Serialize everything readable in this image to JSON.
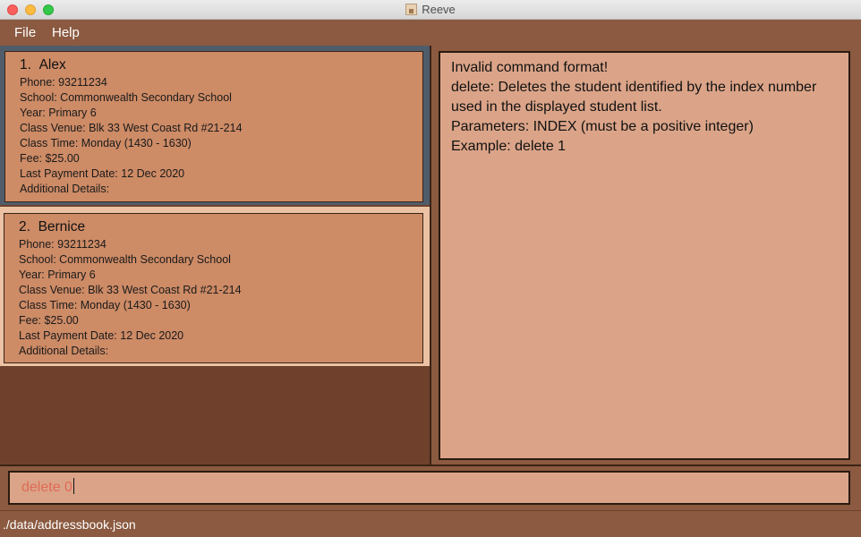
{
  "window": {
    "title": "Reeve"
  },
  "menu": {
    "items": [
      "File",
      "Help"
    ]
  },
  "students": [
    {
      "index": "1.",
      "name": "Alex",
      "phone": "Phone: 93211234",
      "school": "School: Commonwealth Secondary School",
      "year": "Year: Primary 6",
      "venue": "Class Venue: Blk 33 West Coast Rd #21-214",
      "time": "Class Time: Monday (1430 - 1630)",
      "fee": "Fee: $25.00",
      "last_payment": "Last Payment Date: 12 Dec 2020",
      "details": "Additional Details:"
    },
    {
      "index": "2.",
      "name": "Bernice",
      "phone": "Phone: 93211234",
      "school": "School: Commonwealth Secondary School",
      "year": "Year: Primary 6",
      "venue": "Class Venue: Blk 33 West Coast Rd #21-214",
      "time": "Class Time: Monday (1430 - 1630)",
      "fee": "Fee: $25.00",
      "last_payment": "Last Payment Date: 12 Dec 2020",
      "details": "Additional Details:"
    }
  ],
  "result": {
    "lines": [
      "Invalid command format!",
      "delete: Deletes the student identified by the index number",
      "used in the displayed student list.",
      "Parameters: INDEX (must be a positive integer)",
      "Example: delete 1"
    ]
  },
  "command": {
    "value": "delete 0",
    "text_color": "#E06A55"
  },
  "status": {
    "path": "./data/addressbook.json"
  },
  "colors": {
    "background": "#8B5A40",
    "card": "#CD8B66",
    "panel": "#DBA488",
    "selection": "#4F5D6B"
  }
}
